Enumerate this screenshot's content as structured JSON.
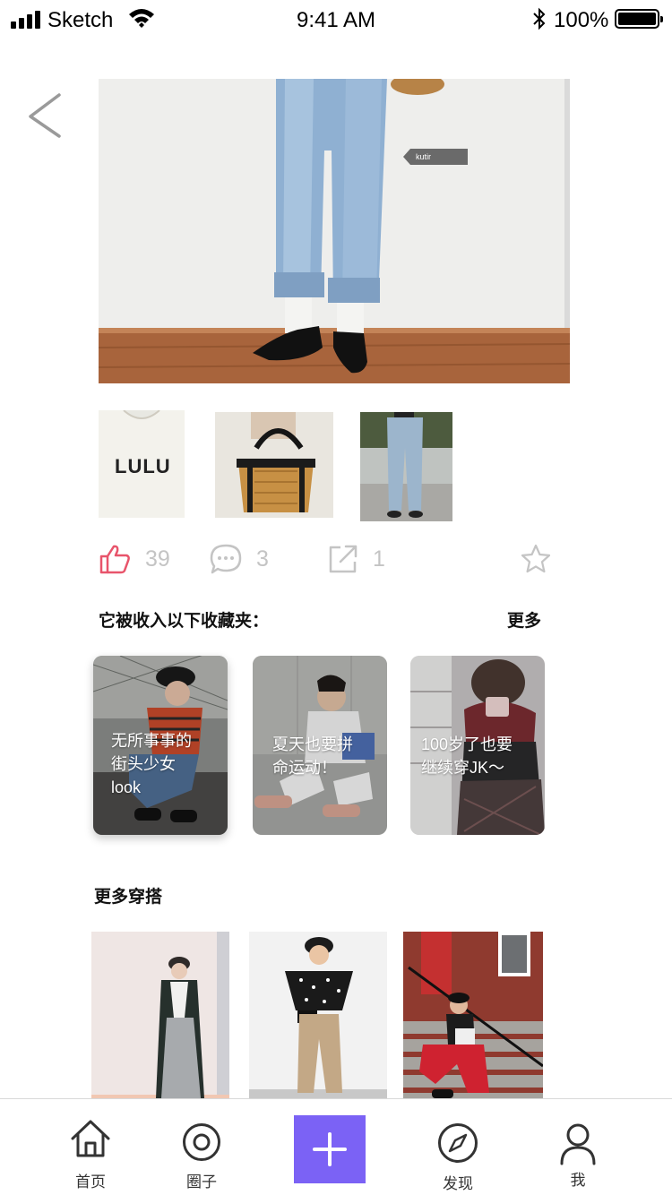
{
  "status_bar": {
    "carrier": "Sketch",
    "time": "9:41 AM",
    "battery": "100%"
  },
  "hero": {
    "tag_label": "kutir"
  },
  "thumbnails": [
    {
      "name": "lulu-tshirt",
      "print_text": "LULU"
    },
    {
      "name": "basket-bag"
    },
    {
      "name": "jeans-street"
    }
  ],
  "actions": {
    "likes": "39",
    "comments": "3",
    "shares": "1"
  },
  "collections": {
    "title": "它被收入以下收藏夹：",
    "more": "更多",
    "cards": [
      {
        "line1": "无所事事的",
        "line2": "街头少女",
        "line3": "look"
      },
      {
        "line1": "夏天也要拼",
        "line2": "命运动！",
        "line3": ""
      },
      {
        "line1": "100岁了也要",
        "line2": "继续穿JK～",
        "line3": ""
      }
    ]
  },
  "more_outfits": {
    "title": "更多穿搭"
  },
  "tabbar": {
    "home": "首页",
    "circle": "圈子",
    "discover": "发现",
    "me": "我"
  },
  "colors": {
    "accent": "#7b62f5",
    "like": "#e8546b",
    "muted_icon": "#c4c4c4"
  }
}
